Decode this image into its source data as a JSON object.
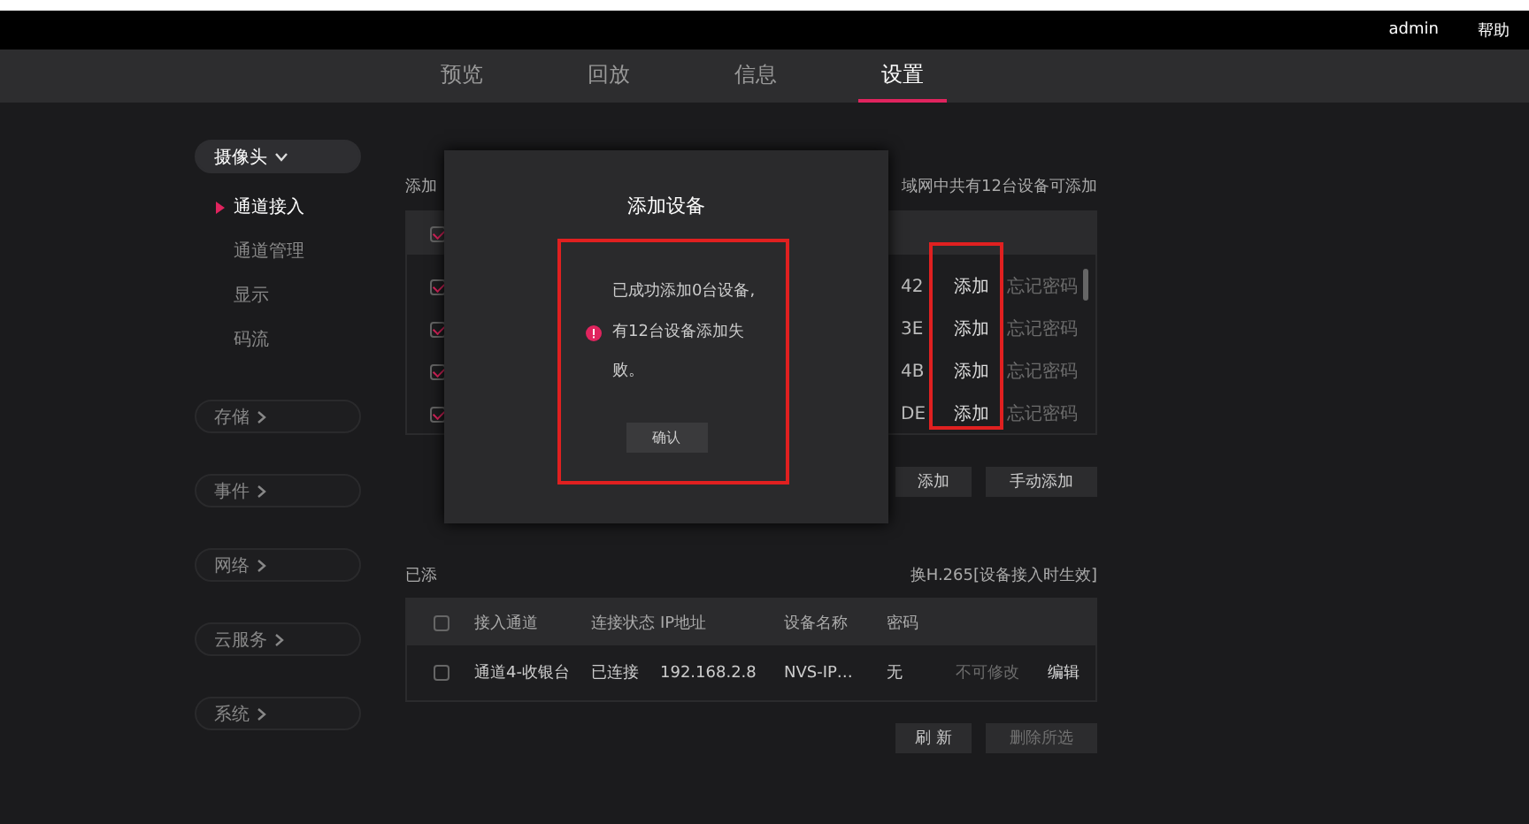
{
  "header": {
    "user": "admin",
    "help": "帮助"
  },
  "tabs": [
    {
      "label": "预览",
      "selected": false
    },
    {
      "label": "回放",
      "selected": false
    },
    {
      "label": "信息",
      "selected": false
    },
    {
      "label": "设置",
      "selected": true
    }
  ],
  "sidebar": {
    "groups": [
      {
        "label": "摄像头",
        "expanded": true,
        "items": [
          {
            "label": "通道接入",
            "selected": true
          },
          {
            "label": "通道管理",
            "selected": false
          },
          {
            "label": "显示",
            "selected": false
          },
          {
            "label": "码流",
            "selected": false
          }
        ]
      },
      {
        "label": "存储",
        "expanded": false
      },
      {
        "label": "事件",
        "expanded": false
      },
      {
        "label": "网络",
        "expanded": false
      },
      {
        "label": "云服务",
        "expanded": false
      },
      {
        "label": "系统",
        "expanded": false
      }
    ]
  },
  "scan_section": {
    "label": "添加",
    "summary": "域网中共有12台设备可添加",
    "header_checked": true,
    "rows": [
      {
        "checked": true,
        "column_1": "42",
        "action": "添加",
        "column_3": "忘记密码"
      },
      {
        "checked": true,
        "column_1": "3E",
        "action": "添加",
        "column_3": "忘记密码"
      },
      {
        "checked": true,
        "column_1": "4B",
        "action": "添加",
        "column_3": "忘记密码"
      },
      {
        "checked": true,
        "column_1": "DE",
        "action": "添加",
        "column_3": "忘记密码"
      }
    ],
    "buttons": [
      {
        "label": "添加",
        "disabled": false
      },
      {
        "label": "手动添加",
        "disabled": false
      }
    ]
  },
  "added_section": {
    "label": "已添",
    "note": "换H.265[设备接入时生效]",
    "header_checked": false,
    "columns": [
      "接入通道",
      "连接状态",
      "IP地址",
      "设备名称",
      "密码"
    ],
    "rows": [
      {
        "checked": false,
        "cells": [
          "通道4-收银台",
          "已连接",
          "192.168.2.8",
          "NVS-IP…",
          "无"
        ],
        "column_6": "不可修改",
        "action": "编辑"
      }
    ],
    "buttons": [
      {
        "label": "刷 新",
        "disabled": false
      },
      {
        "label": "删除所选",
        "disabled": true
      }
    ]
  },
  "dialog": {
    "title": "添加设备",
    "messages": [
      {
        "kind": "info",
        "text": "已成功添加0台设备,"
      },
      {
        "kind": "error",
        "text": "有12台设备添加失败。"
      }
    ],
    "confirm": "确认"
  }
}
